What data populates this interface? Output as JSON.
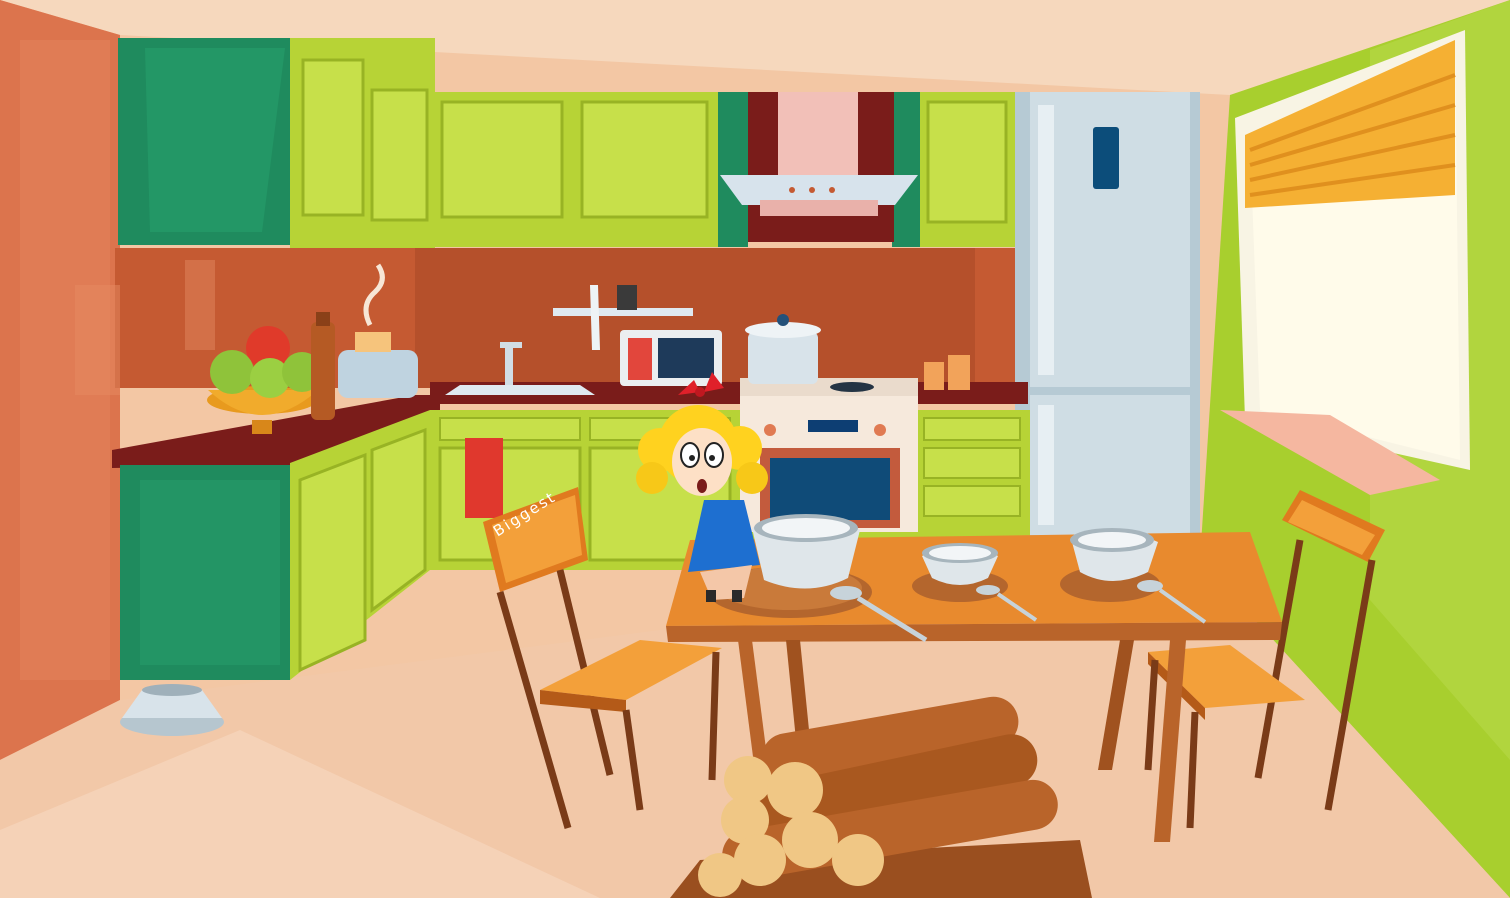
{
  "scene": {
    "chair_label": "Biggest"
  },
  "colors": {
    "wall_left": "#e07a52",
    "wall_back": "#f3c7a4",
    "wall_right": "#a8cf2e",
    "floor": "#f2c8a8",
    "cabinet_lime": "#b7d336",
    "cabinet_green": "#1f8b5e",
    "backsplash": "#c55a32",
    "table_top": "#e88a2e",
    "girl_dress": "#1e6fd0",
    "girl_hair": "#ffd21f",
    "firewood": "#b9642a"
  }
}
